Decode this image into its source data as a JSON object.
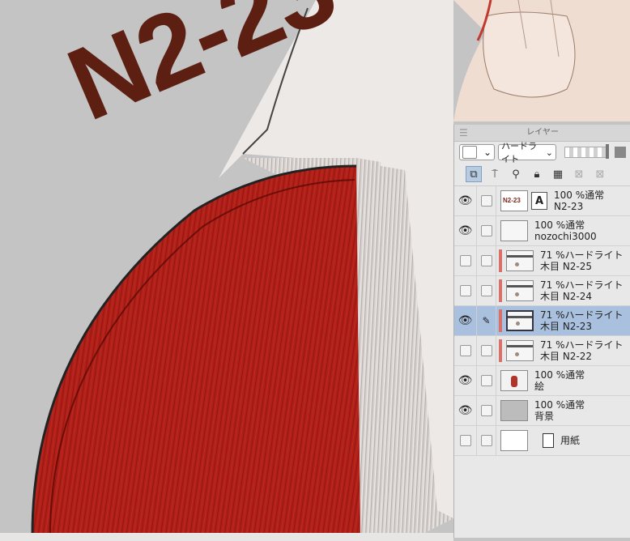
{
  "overlay": {
    "text": "N2-23"
  },
  "panel": {
    "title": "レイヤー",
    "blend_mode": "ハードライト",
    "opacity": 1.0
  },
  "toolbar_icons": [
    "layer-new-icon",
    "clipping-icon",
    "reference-icon",
    "lock-icon",
    "transparency-lock-icon",
    "mask-icon",
    "delete-icon"
  ],
  "layers": [
    {
      "visible": true,
      "locked": false,
      "opacity_mode": "100 %通常",
      "name": "N2-23",
      "type": "vector-text",
      "clip": false,
      "selected": false
    },
    {
      "visible": true,
      "locked": false,
      "opacity_mode": "100 %通常",
      "name": "nozochi3000",
      "type": "raster",
      "clip": false,
      "selected": false
    },
    {
      "visible": false,
      "locked": false,
      "opacity_mode": "71 %ハードライト",
      "name": "木目 N2-25",
      "type": "raster",
      "clip": true,
      "selected": false
    },
    {
      "visible": false,
      "locked": false,
      "opacity_mode": "71 %ハードライト",
      "name": "木目 N2-24",
      "type": "raster",
      "clip": true,
      "selected": false
    },
    {
      "visible": true,
      "locked": false,
      "opacity_mode": "71 %ハードライト",
      "name": "木目 N2-23",
      "type": "raster",
      "clip": true,
      "selected": true
    },
    {
      "visible": false,
      "locked": false,
      "opacity_mode": "71 %ハードライト",
      "name": "木目 N2-22",
      "type": "raster",
      "clip": true,
      "selected": false
    },
    {
      "visible": true,
      "locked": false,
      "opacity_mode": "100 %通常",
      "name": "絵",
      "type": "raster",
      "clip": false,
      "selected": false
    },
    {
      "visible": true,
      "locked": false,
      "opacity_mode": "100 %通常",
      "name": "背景",
      "type": "raster",
      "clip": false,
      "selected": false
    },
    {
      "visible": false,
      "locked": false,
      "opacity_mode": "",
      "name": "用紙",
      "type": "paper",
      "clip": false,
      "selected": false
    }
  ],
  "colors": {
    "accent_selected": "#a9c1df",
    "clip_bar": "#d9706a",
    "text_overlay": "#5c1f12",
    "wood_red": "#b1221a"
  }
}
